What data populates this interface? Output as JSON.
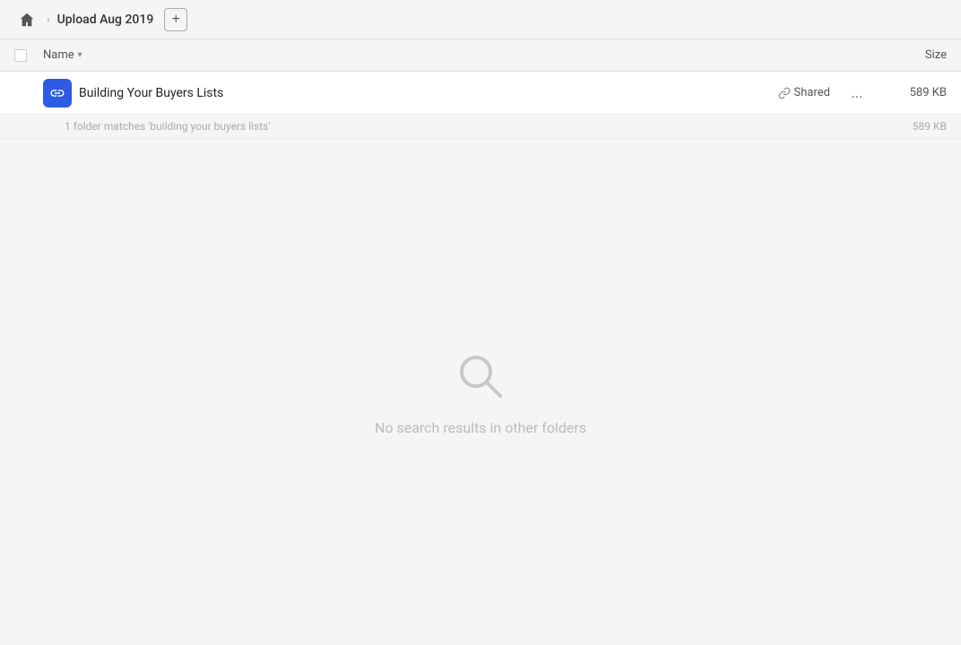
{
  "header": {
    "home_label": "Home",
    "breadcrumb_title": "Upload Aug 2019",
    "add_button_label": "+"
  },
  "columns": {
    "name_label": "Name",
    "size_label": "Size"
  },
  "file_row": {
    "name": "Building Your Buyers Lists",
    "shared_label": "Shared",
    "more_label": "...",
    "size": "589 KB"
  },
  "match_row": {
    "text": "1 folder matches 'building your buyers lists'",
    "size": "589 KB"
  },
  "empty_state": {
    "message": "No search results in other folders"
  }
}
